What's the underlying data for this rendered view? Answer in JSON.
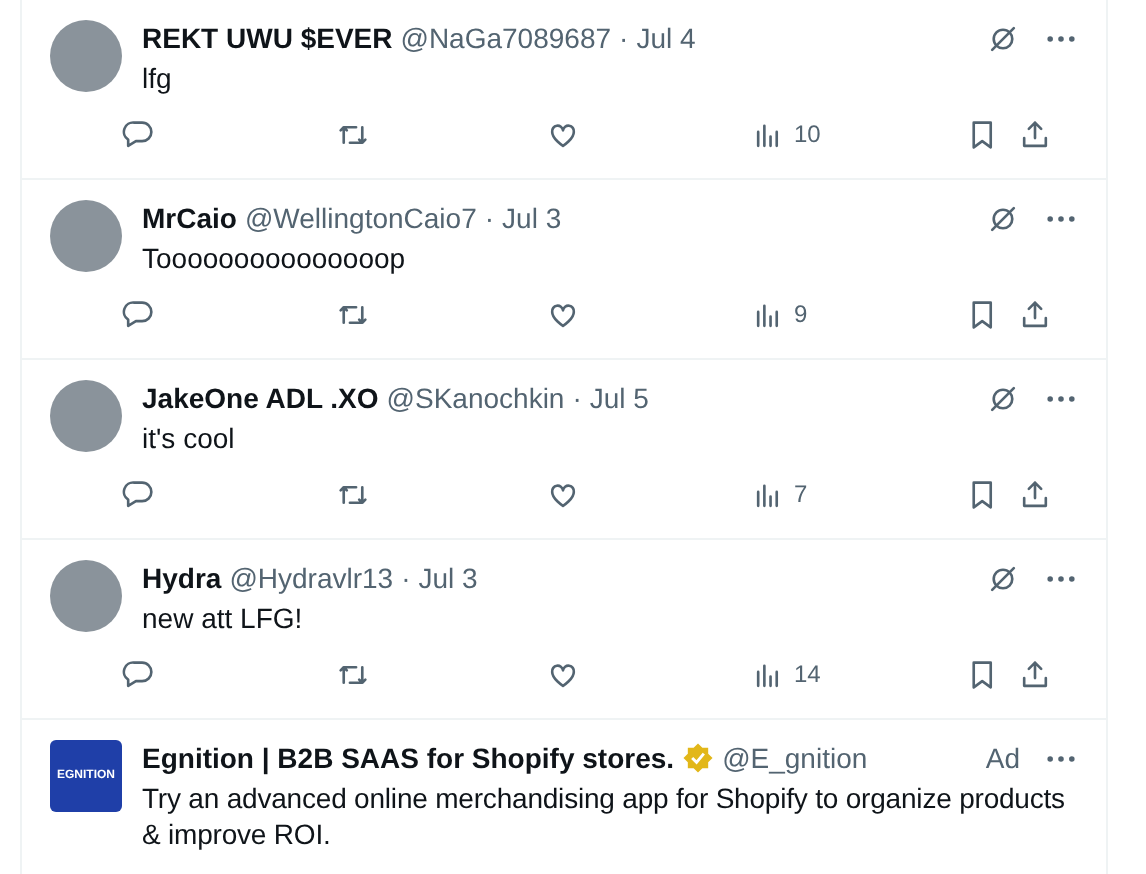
{
  "posts": [
    {
      "name": "REKT UWU $EVER",
      "handle": "@NaGa7089687",
      "date": "Jul 4",
      "text": "lfg",
      "views": "10",
      "sep": "·"
    },
    {
      "name": "MrCaio",
      "handle": "@WellingtonCaio7",
      "date": "Jul 3",
      "text": "Tooooooooooooooop",
      "views": "9",
      "sep": "·"
    },
    {
      "name": "JakeOne ADL .XO",
      "handle": "@SKanochkin",
      "date": "Jul 5",
      "text": "it's cool",
      "views": "7",
      "sep": "·"
    },
    {
      "name": "Hydra",
      "handle": "@Hydravlr13",
      "date": "Jul 3",
      "text": "new att LFG!",
      "views": "14",
      "sep": "·"
    }
  ],
  "ad": {
    "name": "Egnition | B2B SAAS for Shopify stores.",
    "verified": true,
    "handle": "@E_gnition",
    "label": "Ad",
    "logo_text": "EGNITION",
    "text": "Try an advanced online merchandising app for Shopify to organize products & improve ROI."
  }
}
